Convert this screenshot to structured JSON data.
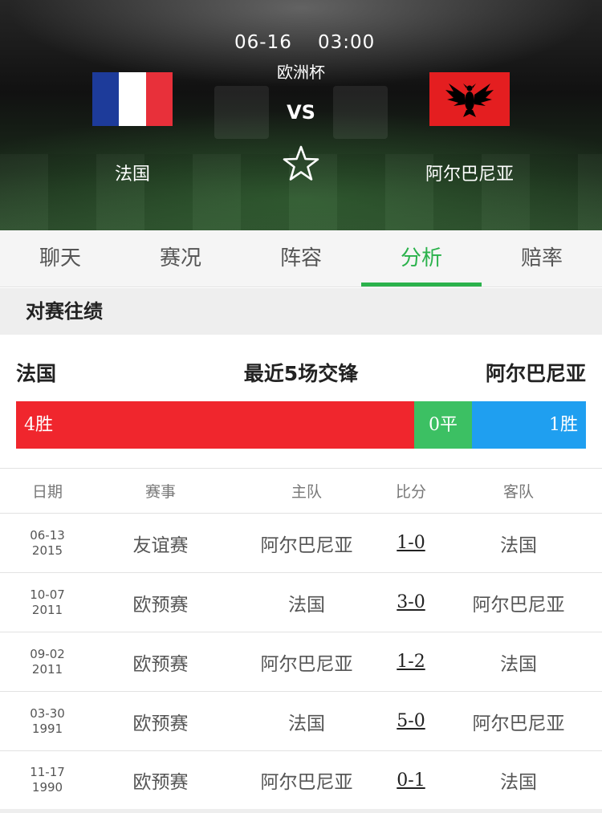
{
  "match": {
    "date": "06-16",
    "time": "03:00",
    "league": "欧洲杯",
    "vs_label": "VS",
    "home_team": "法国",
    "away_team": "阿尔巴尼亚",
    "home_flag_colors": [
      "#1d3b9a",
      "#ffffff",
      "#e8303a"
    ],
    "away_flag_color": "#e41e20"
  },
  "tabs": [
    {
      "label": "聊天",
      "active": false
    },
    {
      "label": "赛况",
      "active": false
    },
    {
      "label": "阵容",
      "active": false
    },
    {
      "label": "分析",
      "active": true
    },
    {
      "label": "赔率",
      "active": false
    }
  ],
  "section": {
    "title": "对赛往绩"
  },
  "h2h": {
    "home": "法国",
    "summary": "最近5场交锋",
    "away": "阿尔巴尼亚",
    "wins_label": "4胜",
    "draws_label": "0平",
    "losses_label": "1胜",
    "wins": 4,
    "draws": 0,
    "losses": 1,
    "colors": {
      "win": "#f0262d",
      "draw": "#3cc063",
      "loss": "#1f9ff0"
    }
  },
  "table": {
    "headers": {
      "date": "日期",
      "competition": "赛事",
      "home": "主队",
      "score": "比分",
      "away": "客队"
    },
    "rows": [
      {
        "date_md": "06-13",
        "year": "2015",
        "competition": "友谊赛",
        "home": "阿尔巴尼亚",
        "score": "1-0",
        "away": "法国"
      },
      {
        "date_md": "10-07",
        "year": "2011",
        "competition": "欧预赛",
        "home": "法国",
        "score": "3-0",
        "away": "阿尔巴尼亚"
      },
      {
        "date_md": "09-02",
        "year": "2011",
        "competition": "欧预赛",
        "home": "阿尔巴尼亚",
        "score": "1-2",
        "away": "法国"
      },
      {
        "date_md": "03-30",
        "year": "1991",
        "competition": "欧预赛",
        "home": "法国",
        "score": "5-0",
        "away": "阿尔巴尼亚"
      },
      {
        "date_md": "11-17",
        "year": "1990",
        "competition": "欧预赛",
        "home": "阿尔巴尼亚",
        "score": "0-1",
        "away": "法国"
      }
    ]
  },
  "icons": {
    "favorite": "star-outline-icon"
  }
}
